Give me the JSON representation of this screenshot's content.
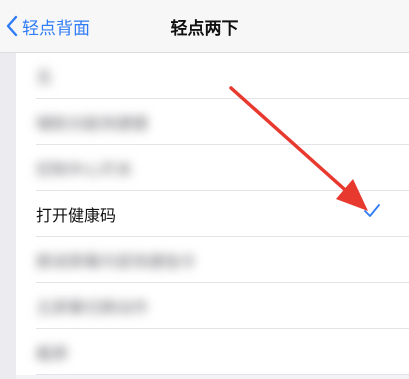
{
  "nav": {
    "back_label": "轻点背面",
    "title": "轻点两下"
  },
  "rows": [
    {
      "label": "无",
      "blurred": true
    },
    {
      "label": "辅助功能快捷键",
      "blurred": true
    },
    {
      "label": "控制中心开关",
      "blurred": true
    },
    {
      "label": "打开健康码",
      "blurred": false,
      "checked": true
    },
    {
      "label": "朗读屏幕内容快捷指令",
      "blurred": true
    },
    {
      "label": "主屏幕切换动作",
      "blurred": true
    },
    {
      "label": "截屏",
      "blurred": true
    }
  ],
  "colors": {
    "accent": "#2f7cf6",
    "arrow": "#e8392f"
  }
}
